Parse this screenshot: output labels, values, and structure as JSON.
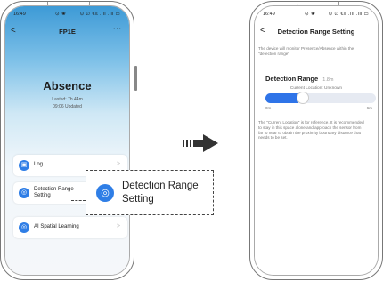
{
  "left_phone": {
    "status": {
      "time": "16:49",
      "mid": "⊙ ❀",
      "right": "⊙ ∅ €≤ .ııl .ııl ▭"
    },
    "nav": {
      "back": "<",
      "title": "FP1E",
      "more": "···"
    },
    "state": "Absence",
    "lasted": "Lasted: 7h 44m",
    "updated": "09:06 Updated",
    "cards": [
      {
        "label": "Log",
        "chevron": ">"
      },
      {
        "label": "Detection Range",
        "label2": "Setting",
        "chevron": ""
      },
      {
        "label": "AI Spatial Learning",
        "chevron": ">"
      }
    ]
  },
  "callout": {
    "line1": "Detection Range",
    "line2": "Setting"
  },
  "right_phone": {
    "status": {
      "time": "16:49",
      "mid": "⊙ ❀",
      "right": "⊙ ∅ €≤ .ııl .ııl ▭"
    },
    "nav": {
      "back": "<",
      "title": "Detection Range Setting"
    },
    "intro_line1": "The device will monitor Presence/Absence within the",
    "intro_line2": "\"detection range\"",
    "range_label": "Detection Range",
    "range_value": "1.8m",
    "current_location": "Current Location: Unknown",
    "slider_value_fraction": 0.3,
    "min_label": "0m",
    "max_label": "6m",
    "note_lines": [
      "The \"Current Location\" is for reference. It is recommended",
      "to stay in this space alone and approach the sensor from",
      "far to near to obtain the proximity boundary distance that",
      "needs to be set."
    ]
  },
  "colors": {
    "accent": "#2f7ee6"
  }
}
